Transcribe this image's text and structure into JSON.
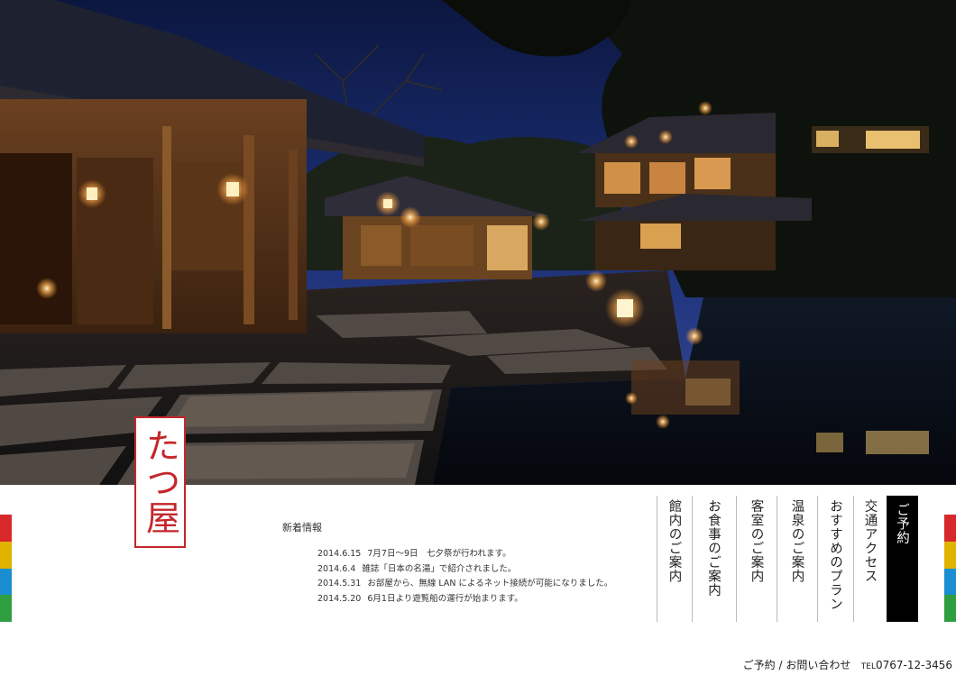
{
  "brand": {
    "logo_text": "たつ屋",
    "logo_color": "#c4262b"
  },
  "news": {
    "title": "新着情報",
    "items": [
      {
        "date": "2014.6.15",
        "text": "7月7日～9日　七夕祭が行われます。"
      },
      {
        "date": "2014.6.4",
        "text": "雑誌「日本の名湯」で紹介されました。"
      },
      {
        "date": "2014.5.31",
        "text": "お部屋から、無線 LAN によるネット接続が可能になりました。"
      },
      {
        "date": "2014.5.20",
        "text": "6月1日より遊覧船の運行が始まります。"
      }
    ]
  },
  "nav": {
    "items": [
      {
        "label": "館内のご案内"
      },
      {
        "label": "お食事のご案内"
      },
      {
        "label": "客室のご案内"
      },
      {
        "label": "温泉のご案内"
      },
      {
        "label": "おすすめのプラン"
      },
      {
        "label": "交通アクセス"
      }
    ],
    "reserve_label": "ご予約"
  },
  "accent_bars": [
    "#d7282b",
    "#e0b300",
    "#1a8fd0",
    "#2e9e3f"
  ],
  "footer": {
    "contact_label": "ご予約 / お問い合わせ",
    "tel_prefix": "TEL",
    "tel_number": "0767-12-3456"
  }
}
